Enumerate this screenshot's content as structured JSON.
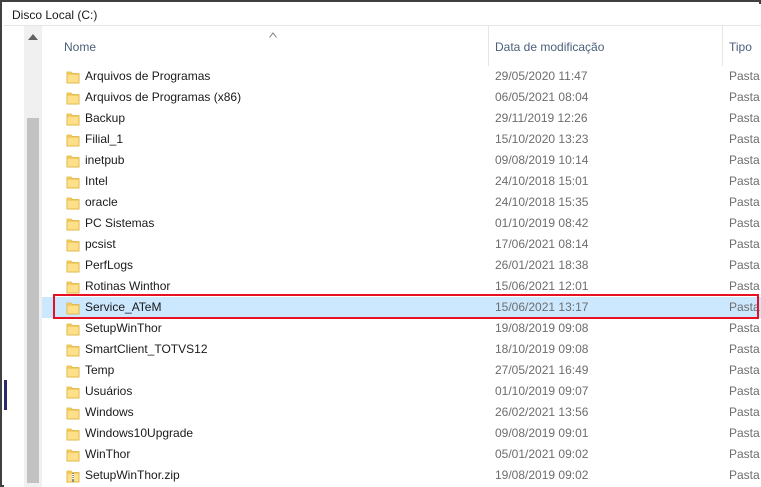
{
  "window": {
    "title": "Disco Local (C:)"
  },
  "columns": {
    "name": "Nome",
    "date": "Data de modificação",
    "type": "Tipo"
  },
  "colors": {
    "selection": "#cce8ff",
    "highlight_border": "#e81123",
    "folder": "#ffd766"
  },
  "rows": [
    {
      "name": "Arquivos de Programas",
      "date": "29/05/2020 11:47",
      "type": "Pasta",
      "icon": "folder-icon"
    },
    {
      "name": "Arquivos de Programas (x86)",
      "date": "06/05/2021 08:04",
      "type": "Pasta",
      "icon": "folder-icon"
    },
    {
      "name": "Backup",
      "date": "29/11/2019 12:26",
      "type": "Pasta",
      "icon": "folder-icon"
    },
    {
      "name": "Filial_1",
      "date": "15/10/2020 13:23",
      "type": "Pasta",
      "icon": "folder-icon"
    },
    {
      "name": "inetpub",
      "date": "09/08/2019 10:14",
      "type": "Pasta",
      "icon": "folder-icon"
    },
    {
      "name": "Intel",
      "date": "24/10/2018 15:01",
      "type": "Pasta",
      "icon": "folder-icon"
    },
    {
      "name": "oracle",
      "date": "24/10/2018 15:35",
      "type": "Pasta",
      "icon": "folder-icon"
    },
    {
      "name": "PC Sistemas",
      "date": "01/10/2019 08:42",
      "type": "Pasta",
      "icon": "folder-icon"
    },
    {
      "name": "pcsist",
      "date": "17/06/2021 08:14",
      "type": "Pasta",
      "icon": "folder-icon"
    },
    {
      "name": "PerfLogs",
      "date": "26/01/2021 18:38",
      "type": "Pasta",
      "icon": "folder-icon"
    },
    {
      "name": "Rotinas Winthor",
      "date": "15/06/2021 12:01",
      "type": "Pasta",
      "icon": "folder-icon"
    },
    {
      "name": "Service_ATeM",
      "date": "15/06/2021 13:17",
      "type": "Pasta",
      "icon": "folder-icon",
      "selected": true
    },
    {
      "name": "SetupWinThor",
      "date": "19/08/2019 09:08",
      "type": "Pasta",
      "icon": "folder-icon"
    },
    {
      "name": "SmartClient_TOTVS12",
      "date": "18/10/2019 09:08",
      "type": "Pasta",
      "icon": "folder-icon"
    },
    {
      "name": "Temp",
      "date": "27/05/2021 16:49",
      "type": "Pasta",
      "icon": "folder-icon"
    },
    {
      "name": "Usuários",
      "date": "01/10/2019 09:07",
      "type": "Pasta",
      "icon": "folder-icon"
    },
    {
      "name": "Windows",
      "date": "26/02/2021 13:56",
      "type": "Pasta",
      "icon": "folder-icon"
    },
    {
      "name": "Windows10Upgrade",
      "date": "09/08/2019 09:01",
      "type": "Pasta",
      "icon": "folder-icon"
    },
    {
      "name": "WinThor",
      "date": "05/01/2021 09:02",
      "type": "Pasta",
      "icon": "folder-icon"
    },
    {
      "name": "SetupWinThor.zip",
      "date": "19/08/2019 09:02",
      "type": "Pasta",
      "icon": "zip-folder-icon"
    }
  ]
}
